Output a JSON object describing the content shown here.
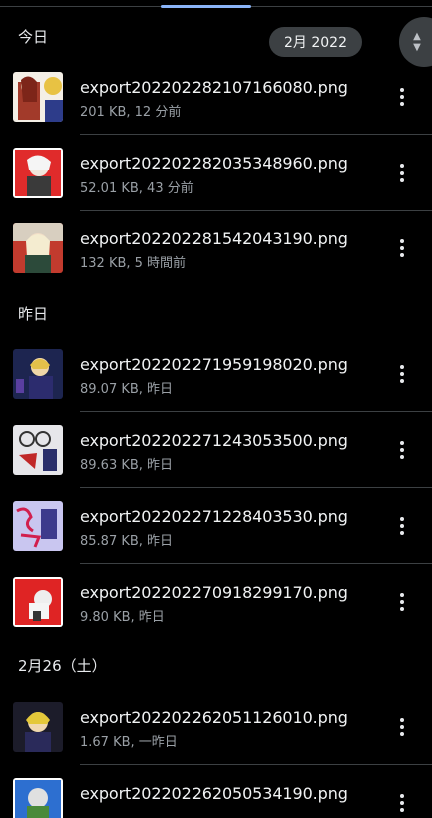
{
  "date_chip": "2月 2022",
  "sections": {
    "today": "今日",
    "yesterday": "昨日",
    "feb26": "2月26（土）"
  },
  "files": [
    {
      "name": "export202202282107166080.png",
      "meta": "201 KB, 12 分前"
    },
    {
      "name": "export202202282035348960.png",
      "meta": "52.01 KB, 43 分前"
    },
    {
      "name": "export202202281542043190.png",
      "meta": "132 KB, 5 時間前"
    },
    {
      "name": "export202202271959198020.png",
      "meta": "89.07 KB, 昨日"
    },
    {
      "name": "export202202271243053500.png",
      "meta": "89.63 KB, 昨日"
    },
    {
      "name": "export202202271228403530.png",
      "meta": "85.87 KB, 昨日"
    },
    {
      "name": "export202202270918299170.png",
      "meta": "9.80 KB, 昨日"
    },
    {
      "name": "export202202262051126010.png",
      "meta": "1.67 KB, 一昨日"
    },
    {
      "name": "export202202262050534190.png",
      "meta": ""
    }
  ],
  "icons": {
    "more": "more-vert-icon",
    "scroll_up": "chevron-up-icon",
    "scroll_down": "chevron-down-icon"
  }
}
